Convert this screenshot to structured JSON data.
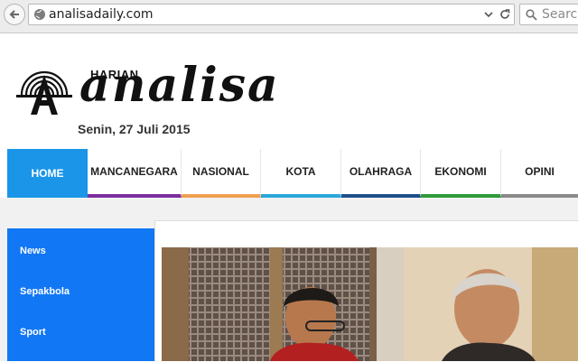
{
  "browser": {
    "url": "analisadaily.com",
    "search_placeholder": "Search"
  },
  "masthead": {
    "harian": "HARIAN",
    "brand": "analisa",
    "date": "Senin, 27 Juli 2015"
  },
  "nav": {
    "items": [
      {
        "label": "HOME",
        "accent": "#1a95e8"
      },
      {
        "label": "MANCANEGARA",
        "accent": "#7b2fa0"
      },
      {
        "label": "NASIONAL",
        "accent": "#f0a050"
      },
      {
        "label": "KOTA",
        "accent": "#2aa7d9"
      },
      {
        "label": "OLAHRAGA",
        "accent": "#1e4f8a"
      },
      {
        "label": "EKONOMI",
        "accent": "#2e9b3a"
      },
      {
        "label": "OPINI",
        "accent": "#8a8a8a"
      }
    ]
  },
  "sidebar": {
    "items": [
      {
        "label": "News"
      },
      {
        "label": "Sepakbola"
      },
      {
        "label": "Sport"
      }
    ]
  }
}
